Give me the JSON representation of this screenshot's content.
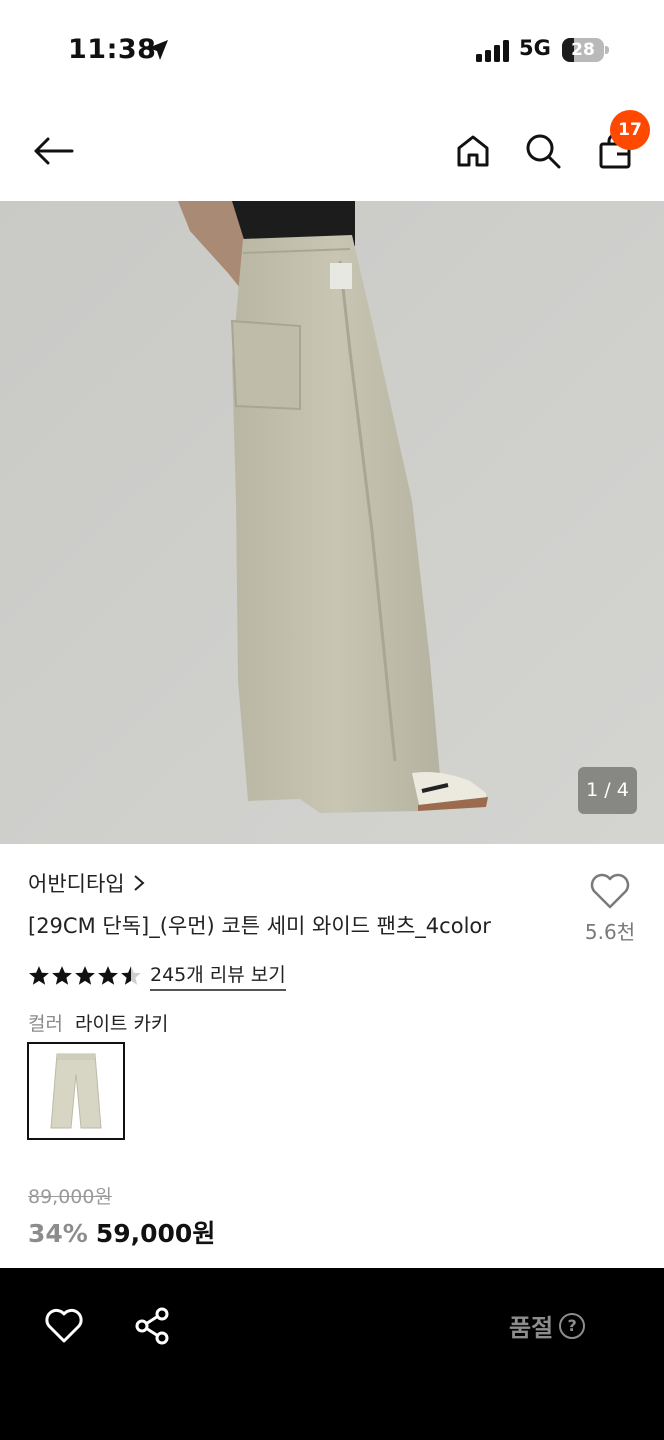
{
  "status_bar": {
    "time": "11:38",
    "network": "5G",
    "battery": "28",
    "battery_level": 0.28
  },
  "nav": {
    "cart_count": "17"
  },
  "hero": {
    "counter": "1 / 4"
  },
  "product": {
    "brand": "어반디타입",
    "title": "[29CM 단독]_(우먼) 코튼 세미 와이드 팬츠_4color",
    "like_count": "5.6천",
    "rating": 4.5,
    "review_link": "245개 리뷰 보기",
    "color_label": "컬러",
    "color_value": "라이트 카키",
    "original_price": "89,000원",
    "discount": "34%",
    "price": "59,000원"
  },
  "bottom_bar": {
    "soldout_label": "품절",
    "help_icon": "?"
  },
  "colors": {
    "accent_badge": "#ff4800",
    "bottom_bar": "#000000",
    "muted_text": "#8d8d8d"
  }
}
